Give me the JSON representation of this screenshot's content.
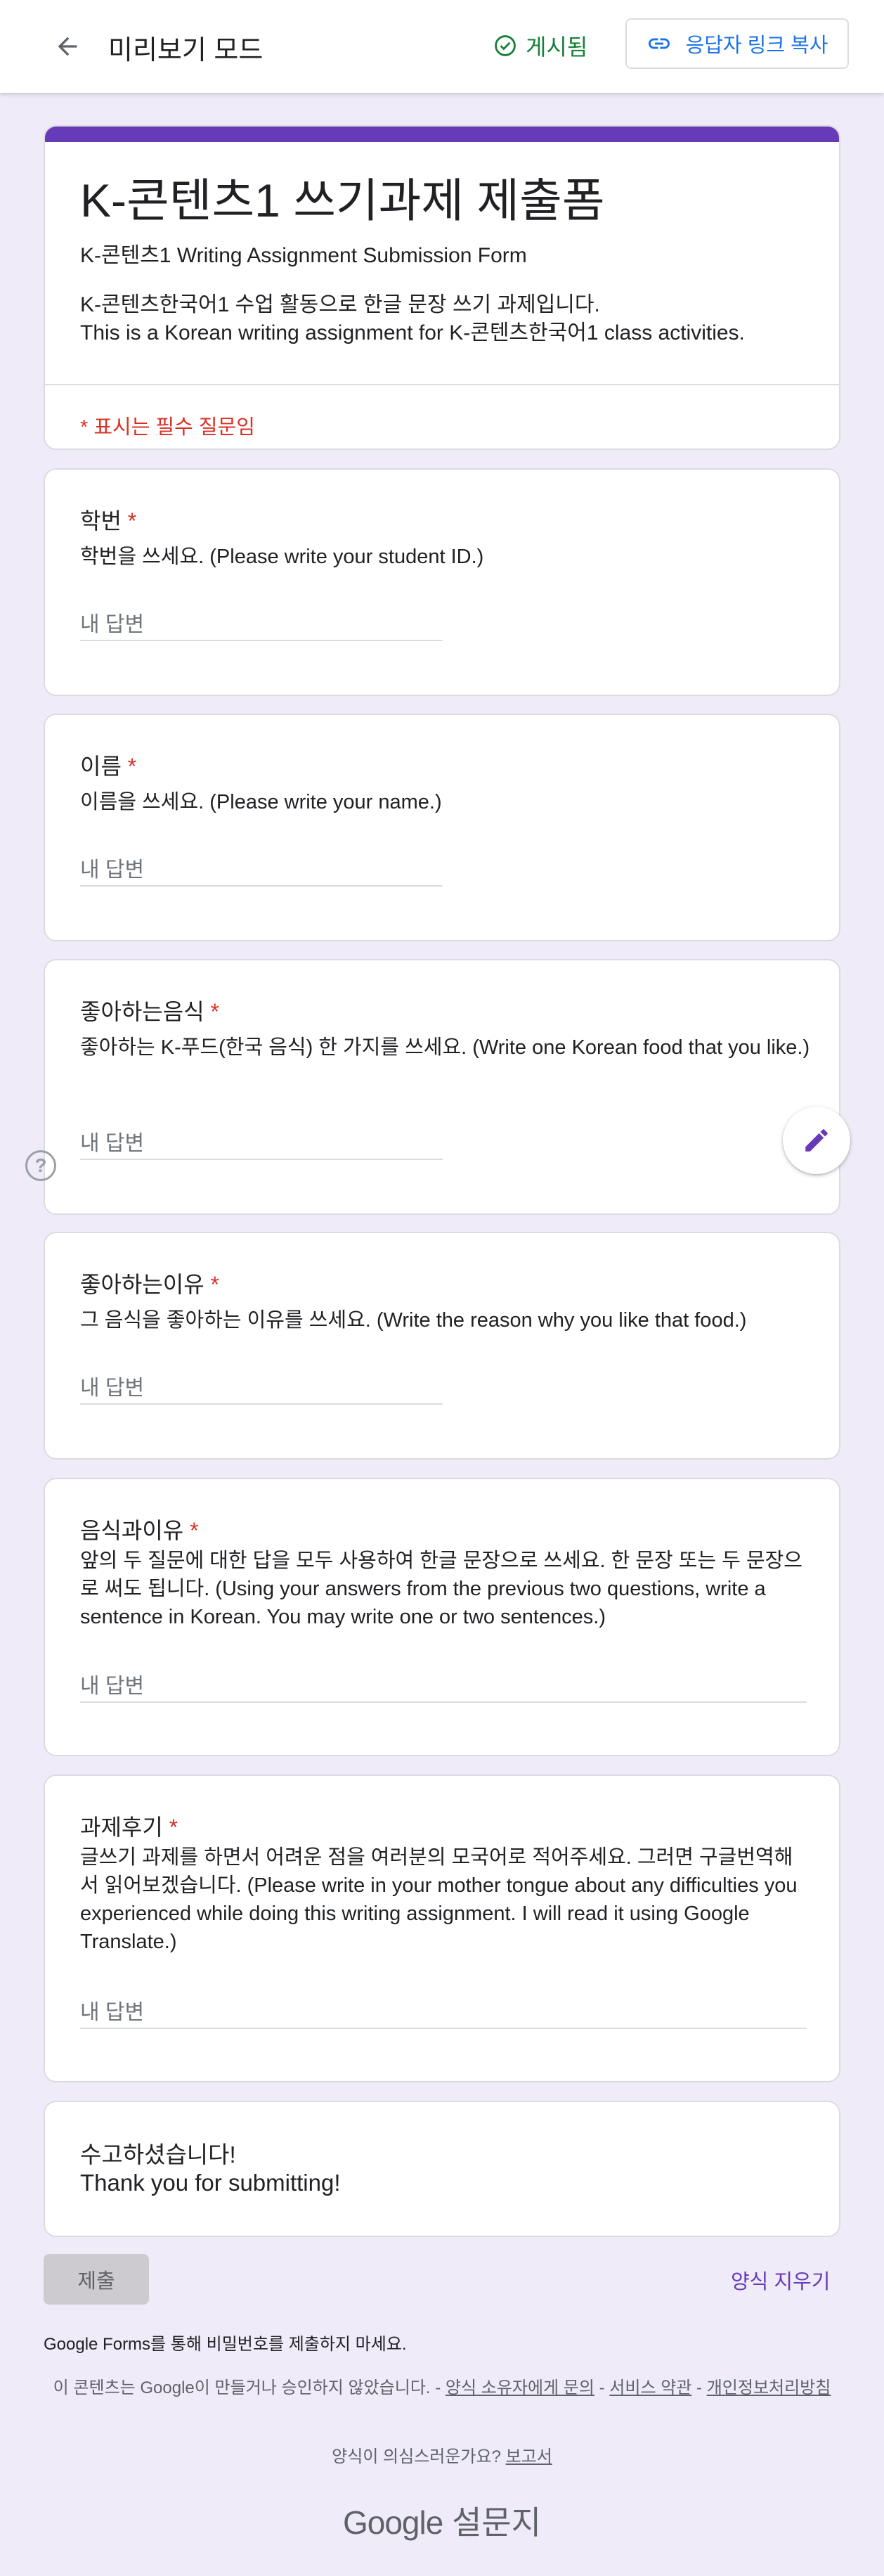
{
  "topbar": {
    "title": "미리보기 모드",
    "published_label": "게시됨",
    "copy_link_label": "응답자 링크 복사"
  },
  "form": {
    "title": "K-콘텐츠1 쓰기과제 제출폼",
    "subtitle": "K-콘텐츠1 Writing Assignment Submission Form",
    "description_line1": "K-콘텐츠한국어1 수업 활동으로 한글 문장 쓰기 과제입니다.",
    "description_line2": "This is a Korean writing assignment for K-콘텐츠한국어1 class activities.",
    "required_note": "* 표시는 필수 질문임"
  },
  "questions": [
    {
      "title": "학번",
      "required": "*",
      "description": "학번을 쓰세요. (Please write your student ID.)",
      "placeholder": "내 답변"
    },
    {
      "title": "이름",
      "required": "*",
      "description": "이름을 쓰세요. (Please write your name.)",
      "placeholder": "내 답변"
    },
    {
      "title": "좋아하는음식",
      "required": "*",
      "description": "좋아하는 K-푸드(한국 음식) 한 가지를 쓰세요. (Write one Korean food that you like.)",
      "placeholder": "내 답변"
    },
    {
      "title": "좋아하는이유",
      "required": "*",
      "description": "그 음식을 좋아하는 이유를 쓰세요. (Write the reason why you like that food.)",
      "placeholder": "내 답변"
    },
    {
      "title": "음식과이유",
      "required": "*",
      "description": "앞의 두 질문에 대한 답을 모두 사용하여 한글 문장으로 쓰세요. 한 문장 또는 두 문장으로 써도 됩니다. (Using your answers from the previous two questions, write a sentence in Korean. You may write one or two sentences.)",
      "placeholder": "내 답변"
    },
    {
      "title": "과제후기",
      "required": "*",
      "description": "글쓰기 과제를 하면서 어려운 점을 여러분의 모국어로 적어주세요. 그러면 구글번역해서 읽어보겠습니다. (Please write in your mother tongue about any difficulties you experienced while doing this writing assignment. I will read it using Google Translate.)",
      "placeholder": "내 답변"
    }
  ],
  "thanks": {
    "line1": "수고하셨습니다!",
    "line2": "Thank you for submitting!"
  },
  "actions": {
    "submit_label": "제출",
    "clear_label": "양식 지우기"
  },
  "footer": {
    "no_password": "Google Forms를 통해 비밀번호를 제출하지 마세요.",
    "disclaimer_prefix": "이 콘텐츠는 Google이 만들거나 승인하지 않았습니다. - ",
    "contact_owner": "양식 소유자에게 문의",
    "sep1": " - ",
    "terms": "서비스 약관",
    "sep2": " - ",
    "privacy": "개인정보처리방침",
    "report_prefix": "양식이 의심스러운가요? ",
    "report_link": "보고서",
    "brand_google": "Google",
    "brand_forms": " 설문지"
  },
  "colors": {
    "accent": "#673ab7",
    "published": "#188038",
    "link": "#1a73e8",
    "required": "#d93025",
    "background": "#f0ebf8"
  },
  "icons": {
    "back": "arrow-left-icon",
    "published": "check-circle-icon",
    "copy_link": "link-icon",
    "help": "help-circle-icon",
    "edit": "pencil-icon"
  }
}
